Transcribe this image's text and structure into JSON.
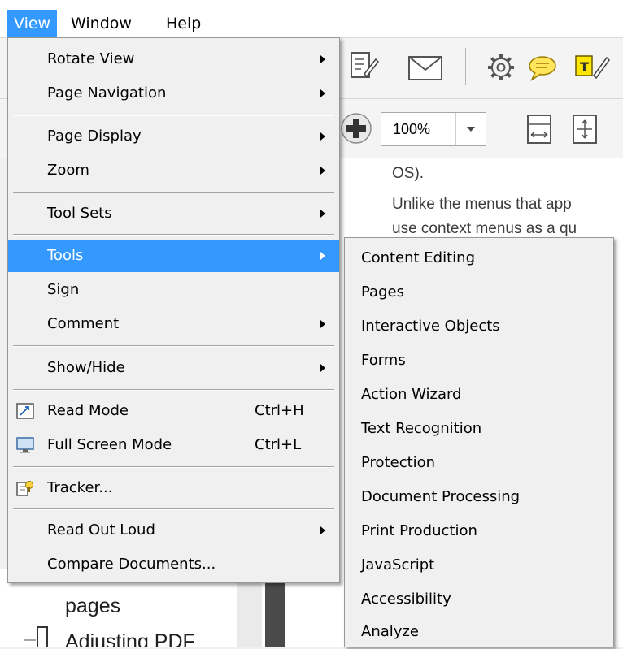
{
  "menubar": {
    "items": [
      {
        "label": "View"
      },
      {
        "label": "Window"
      },
      {
        "label": "Help"
      }
    ]
  },
  "toolbar": {
    "zoom_value": "100%",
    "icons": [
      "edit-document-icon",
      "email-icon",
      "gear-icon",
      "comment-icon",
      "highlight-text-icon",
      "zoom-in-icon",
      "zoom-dropdown-icon",
      "fit-width-icon",
      "fit-page-icon"
    ]
  },
  "document": {
    "lines": [
      "OS).",
      "Unlike the menus that app",
      "use context menus as a qu"
    ]
  },
  "nav_panel": {
    "items": [
      "pages",
      "Adjusting PDF"
    ]
  },
  "view_menu": {
    "items": [
      {
        "label": "Rotate View"
      },
      {
        "label": "Page Navigation"
      },
      {
        "label": "Page Display"
      },
      {
        "label": "Zoom"
      },
      {
        "label": "Tool Sets"
      },
      {
        "label": "Tools"
      },
      {
        "label": "Sign"
      },
      {
        "label": "Comment"
      },
      {
        "label": "Show/Hide"
      },
      {
        "label": "Read Mode",
        "shortcut": "Ctrl+H"
      },
      {
        "label": "Full Screen Mode",
        "shortcut": "Ctrl+L"
      },
      {
        "label": "Tracker..."
      },
      {
        "label": "Read Out Loud"
      },
      {
        "label": "Compare Documents..."
      }
    ]
  },
  "tools_menu": {
    "items": [
      {
        "label": "Content Editing"
      },
      {
        "label": "Pages"
      },
      {
        "label": "Interactive Objects"
      },
      {
        "label": "Forms"
      },
      {
        "label": "Action Wizard"
      },
      {
        "label": "Text Recognition"
      },
      {
        "label": "Protection"
      },
      {
        "label": "Document Processing"
      },
      {
        "label": "Print Production"
      },
      {
        "label": "JavaScript"
      },
      {
        "label": "Accessibility"
      },
      {
        "label": "Analyze"
      }
    ]
  },
  "colors": {
    "highlight": "#3399ff",
    "menu_bg": "#f0f0f0"
  }
}
